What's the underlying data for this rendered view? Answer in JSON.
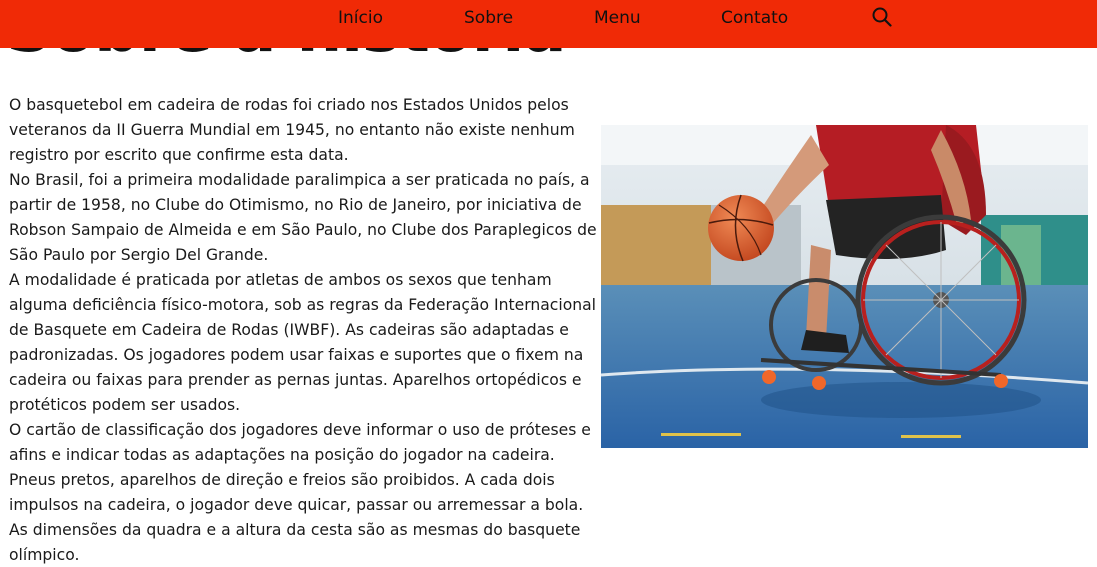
{
  "page_title": "Sobre a história",
  "nav": {
    "items": [
      {
        "label": "Início"
      },
      {
        "label": "Sobre"
      },
      {
        "label": "Menu"
      },
      {
        "label": "Contato"
      }
    ],
    "search_icon": "search-icon",
    "background_color": "#f02a06"
  },
  "article": {
    "paragraphs": [
      "O basquetebol em cadeira de rodas foi criado nos Estados Unidos pelos veteranos da II Guerra Mundial em 1945, no entanto não existe nenhum registro por escrito que confirme esta data.",
      "No Brasil, foi a primeira modalidade paralimpica a ser praticada no país, a partir de 1958, no Clube do Otimismo, no Rio de Janeiro, por iniciativa de Robson Sampaio de Almeida e em São Paulo, no Clube dos Paraplegicos de São Paulo por Sergio Del Grande.",
      "A modalidade é praticada por atletas de ambos os sexos que tenham alguma deficiência físico-motora, sob as regras da Federação Internacional de Basquete em Cadeira de Rodas (IWBF). As cadeiras são adaptadas e padronizadas. Os jogadores podem usar faixas e suportes que o fixem na cadeira ou faixas para prender as pernas juntas. Aparelhos ortopédicos e protéticos podem ser usados.",
      "O cartão de classificação dos jogadores deve informar o uso de próteses e afins e indicar todas as adaptações na posição do jogador na cadeira. Pneus pretos, aparelhos de direção e freios são proibidos. A cada dois impulsos na cadeira, o jogador deve quicar, passar ou arremessar a bola.",
      "As dimensões da quadra e a altura da cesta são as mesmas do basquete olímpico."
    ]
  }
}
